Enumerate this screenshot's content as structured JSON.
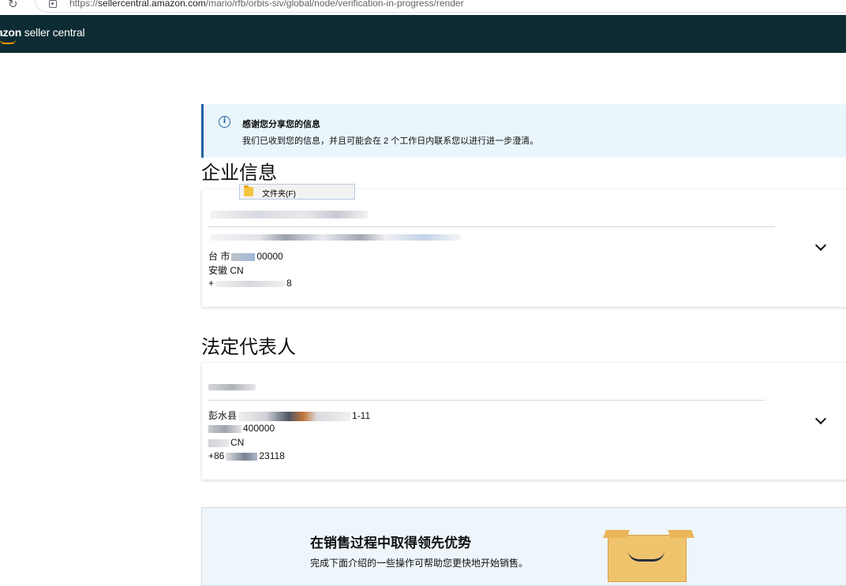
{
  "browser": {
    "url_prefix": "https://",
    "url_host": "sellercentral.amazon.com",
    "url_path": "/mario/rfb/orbis-siv/global/node/verification-in-progress/render",
    "reload_icon": "reload-icon"
  },
  "header": {
    "logo_bold": "azon",
    "logo_rest": " seller central",
    "background": "#0c2b33"
  },
  "alert": {
    "icon": "info-icon",
    "title": "感谢您分享您的信息",
    "body": "我们已收到您的信息，并且可能会在 2 个工作日内联系您以进行进一步澄清。",
    "accent": "#2162a1"
  },
  "business": {
    "heading": "企业信息",
    "lines": [
      "台 市",
      "安徽 CN",
      "+"
    ],
    "postcode": "00000",
    "phone_tail": "8"
  },
  "tooltip": {
    "label": "文件夹(F)"
  },
  "representative": {
    "heading": "法定代表人",
    "address_line": "彭水县",
    "address_tail": "1-11",
    "postcode": "400000",
    "country": "CN",
    "phone_prefix": "+86",
    "phone_tail": "23118"
  },
  "promo": {
    "title": "在销售过程中取得领先优势",
    "subtitle": "完成下面介绍的一些操作可帮助您更快地开始销售。"
  }
}
